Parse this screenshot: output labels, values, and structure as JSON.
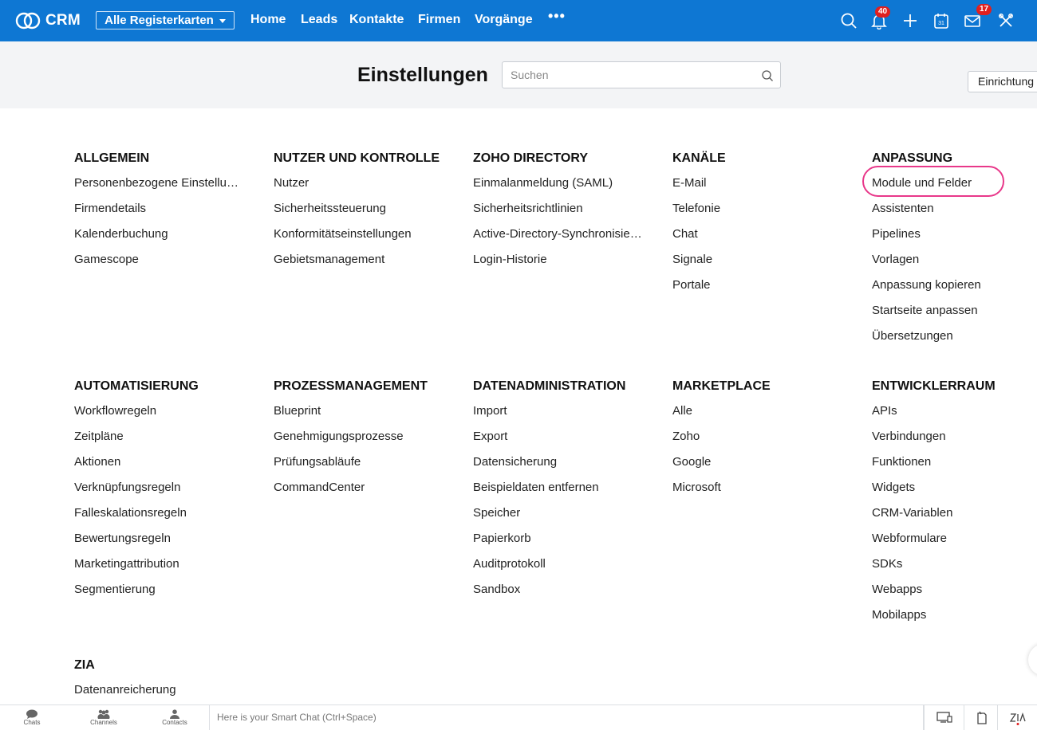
{
  "topbar": {
    "brand": "CRM",
    "tabs_select": "Alle Registerkarten",
    "nav": [
      "Home",
      "Leads",
      "Kontakte",
      "Firmen",
      "Vorgänge"
    ],
    "more": "•••",
    "notifications_badge": "40",
    "mail_badge": "17",
    "calendar_day": "31",
    "icons": [
      "search-icon",
      "bell-icon",
      "plus-icon",
      "calendar-icon",
      "mail-icon",
      "tools-icon"
    ]
  },
  "header": {
    "title": "Einstellungen",
    "search_placeholder": "Suchen",
    "setup_button": "Einrichtung"
  },
  "groups": [
    {
      "title": "ALLGEMEIN",
      "items": [
        "Personenbezogene Einstellungen",
        "Firmendetails",
        "Kalenderbuchung",
        "Gamescope"
      ]
    },
    {
      "title": "NUTZER UND KONTROLLE",
      "items": [
        "Nutzer",
        "Sicherheitssteuerung",
        "Konformitätseinstellungen",
        "Gebietsmanagement"
      ]
    },
    {
      "title": "ZOHO DIRECTORY",
      "items": [
        "Einmalanmeldung (SAML)",
        "Sicherheitsrichtlinien",
        "Active-Directory-Synchronisierung",
        "Login-Historie"
      ]
    },
    {
      "title": "KANÄLE",
      "items": [
        "E-Mail",
        "Telefonie",
        "Chat",
        "Signale",
        "Portale"
      ]
    },
    {
      "title": "ANPASSUNG",
      "items": [
        "Module und Felder",
        "Assistenten",
        "Pipelines",
        "Vorlagen",
        "Anpassung kopieren",
        "Startseite anpassen",
        "Übersetzungen"
      ]
    },
    {
      "title": "AUTOMATISIERUNG",
      "items": [
        "Workflowregeln",
        "Zeitpläne",
        "Aktionen",
        "Verknüpfungsregeln",
        "Falleskalationsregeln",
        "Bewertungsregeln",
        "Marketingattribution",
        "Segmentierung"
      ]
    },
    {
      "title": "PROZESSMANAGEMENT",
      "items": [
        "Blueprint",
        "Genehmigungsprozesse",
        "Prüfungsabläufe",
        "CommandCenter"
      ]
    },
    {
      "title": "DATENADMINISTRATION",
      "items": [
        "Import",
        "Export",
        "Datensicherung",
        "Beispieldaten entfernen",
        "Speicher",
        "Papierkorb",
        "Auditprotokoll",
        "Sandbox"
      ]
    },
    {
      "title": "MARKETPLACE",
      "items": [
        "Alle",
        "Zoho",
        "Google",
        "Microsoft"
      ]
    },
    {
      "title": "ENTWICKLERRAUM",
      "items": [
        "APIs",
        "Verbindungen",
        "Funktionen",
        "Widgets",
        "CRM-Variablen",
        "Webformulare",
        "SDKs",
        "Webapps",
        "Mobilapps"
      ]
    },
    {
      "title": "ZIA",
      "items": [
        "Datenanreicherung"
      ]
    }
  ],
  "bottombar": {
    "tabs": [
      "Chats",
      "Channels",
      "Contacts"
    ],
    "smartchat_placeholder": "Here is your Smart Chat (Ctrl+Space)"
  },
  "colors": {
    "topbar": "#0e77d3",
    "highlight": "#e8388a",
    "badge": "#e02020"
  }
}
